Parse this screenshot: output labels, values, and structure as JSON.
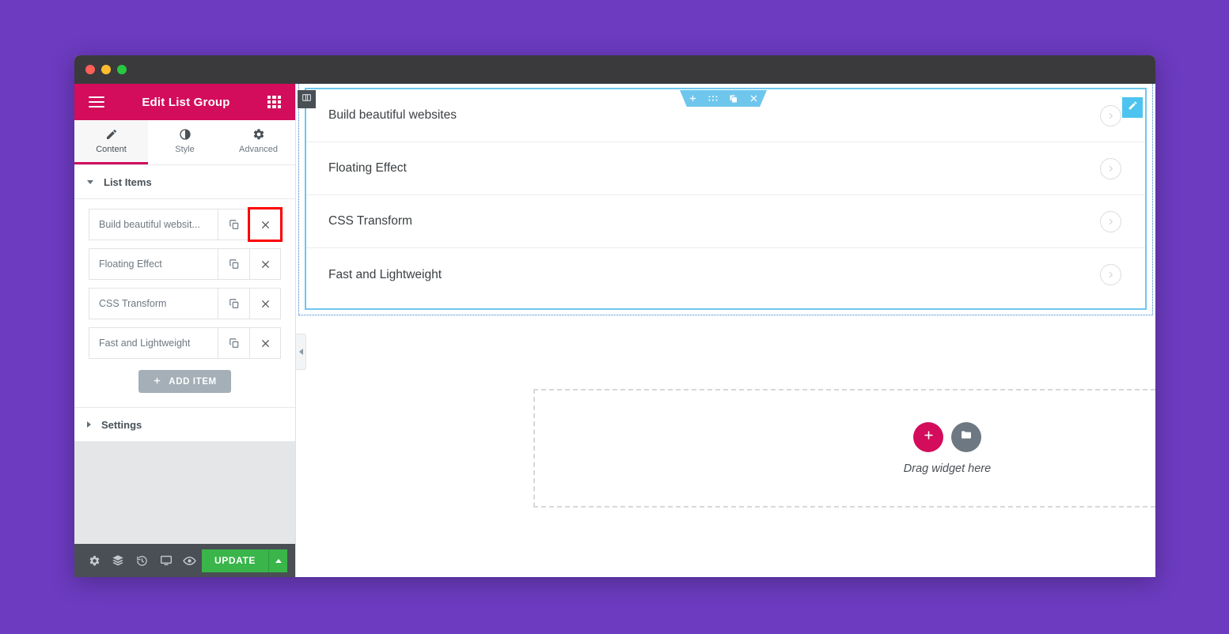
{
  "theme": {
    "desktop_bg": "#6c3bc0",
    "panel_header_bg": "#d30c5c",
    "accent_pink": "#d30c5c",
    "update_green": "#39b54a",
    "widget_cyan": "#6ec6ed",
    "highlight_red": "#ff0000"
  },
  "window": {
    "traffic_lights": [
      "close-red",
      "minimize-yellow",
      "maximize-green"
    ]
  },
  "panel": {
    "menu_icon": "hamburger-icon",
    "title": "Edit List Group",
    "apps_icon": "grid-apps-icon",
    "tabs": [
      {
        "label": "Content",
        "icon": "pencil-icon",
        "active": true
      },
      {
        "label": "Style",
        "icon": "contrast-circle-icon",
        "active": false
      },
      {
        "label": "Advanced",
        "icon": "gear-icon",
        "active": false
      }
    ],
    "sections": [
      {
        "label": "List Items",
        "expanded": true
      },
      {
        "label": "Settings",
        "expanded": false
      }
    ],
    "list_items": [
      {
        "title": "Build beautiful websit...",
        "duplicate_icon": "copy-icon",
        "remove_icon": "close-x-icon",
        "remove_highlighted": true
      },
      {
        "title": "Floating Effect",
        "duplicate_icon": "copy-icon",
        "remove_icon": "close-x-icon",
        "remove_highlighted": false
      },
      {
        "title": "CSS Transform",
        "duplicate_icon": "copy-icon",
        "remove_icon": "close-x-icon",
        "remove_highlighted": false
      },
      {
        "title": "Fast and Lightweight",
        "duplicate_icon": "copy-icon",
        "remove_icon": "close-x-icon",
        "remove_highlighted": false
      }
    ],
    "add_item_label": "ADD ITEM",
    "add_item_icon": "plus-icon",
    "footer": {
      "icons": [
        {
          "name": "gear-icon",
          "title": "Settings"
        },
        {
          "name": "layers-icon",
          "title": "Navigator"
        },
        {
          "name": "history-icon",
          "title": "History"
        },
        {
          "name": "monitor-icon",
          "title": "Responsive Mode"
        },
        {
          "name": "eye-icon",
          "title": "Preview Changes"
        }
      ],
      "update_label": "UPDATE",
      "update_caret_icon": "caret-up-icon"
    }
  },
  "canvas": {
    "collapse_handle_icon": "chevron-left-icon",
    "column_handle_icon": "column-layout-icon",
    "widget_toolbar": [
      {
        "name": "add-icon",
        "glyph": "+"
      },
      {
        "name": "drag-dots-icon",
        "glyph": ""
      },
      {
        "name": "duplicate-icon",
        "glyph": ""
      },
      {
        "name": "close-x-icon",
        "glyph": ""
      }
    ],
    "edit_pencil_icon": "pencil-edit-icon",
    "list_rows": [
      {
        "text": "Build beautiful websites",
        "arrow_icon": "chevron-right-circle-icon"
      },
      {
        "text": "Floating Effect",
        "arrow_icon": "chevron-right-circle-icon"
      },
      {
        "text": "CSS Transform",
        "arrow_icon": "chevron-right-circle-icon"
      },
      {
        "text": "Fast and Lightweight",
        "arrow_icon": "chevron-right-circle-icon"
      }
    ],
    "dropzone": {
      "add_icon": "plus-icon",
      "folder_icon": "folder-icon",
      "label": "Drag widget here"
    }
  }
}
